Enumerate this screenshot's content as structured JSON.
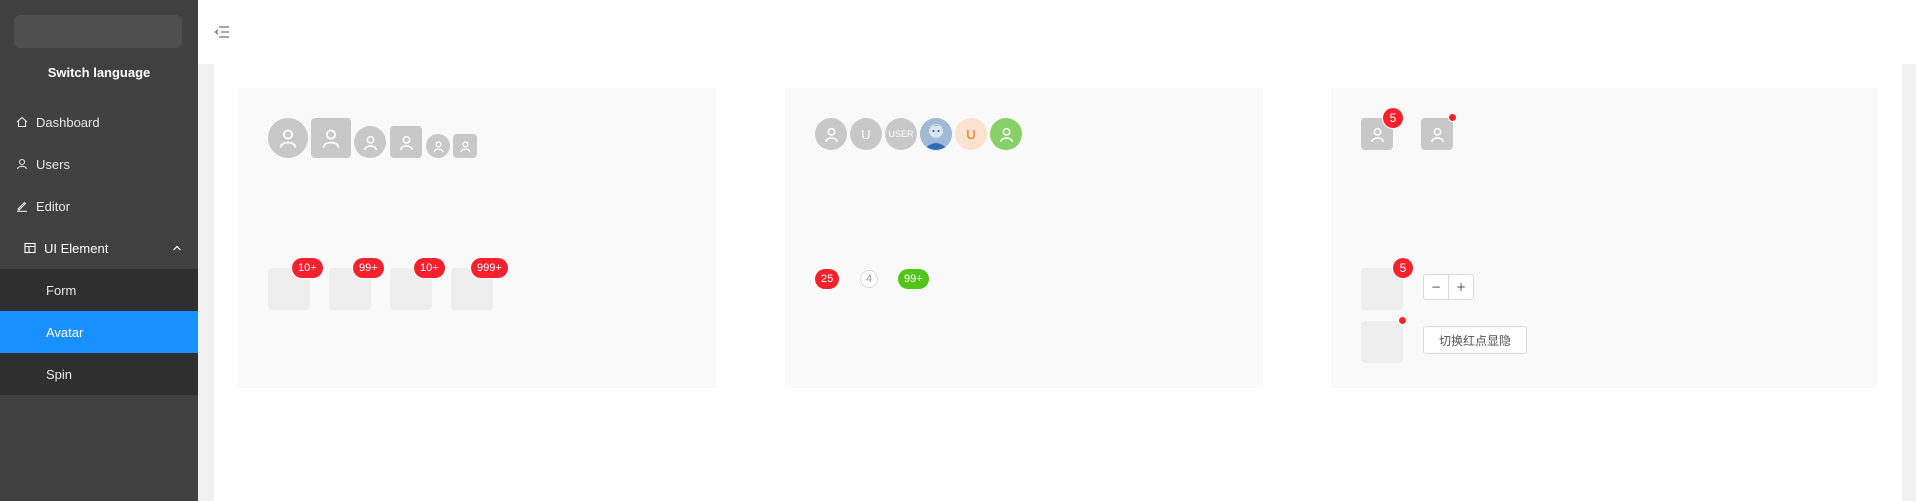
{
  "sidebar": {
    "switch_language": "Switch language",
    "items": [
      {
        "label": "Dashboard",
        "icon": "home-icon"
      },
      {
        "label": "Users",
        "icon": "user-icon"
      },
      {
        "label": "Editor",
        "icon": "edit-icon"
      },
      {
        "label": "UI Element",
        "icon": "layout-icon",
        "expanded": true
      }
    ],
    "sub_items": [
      {
        "label": "Form"
      },
      {
        "label": "Avatar",
        "active": true
      },
      {
        "label": "Spin"
      }
    ]
  },
  "header": {
    "menu_icon": "menu-fold-icon"
  },
  "card1": {
    "badges": [
      "10+",
      "99+",
      "10+",
      "999+"
    ]
  },
  "card2": {
    "avatars": [
      {
        "kind": "icon"
      },
      {
        "kind": "text",
        "text": "U"
      },
      {
        "kind": "text",
        "text": "USER"
      },
      {
        "kind": "image"
      },
      {
        "kind": "text",
        "text": "U",
        "color": "#f56a00",
        "bg": "#fde3cf"
      },
      {
        "kind": "icon",
        "bg": "#87d068"
      }
    ],
    "badges": [
      {
        "text": "25",
        "style": "red"
      },
      {
        "text": "4",
        "style": "outline"
      },
      {
        "text": "99+",
        "style": "green"
      }
    ]
  },
  "card3": {
    "top_badge": "5",
    "dyn_badge": "5",
    "minus_label": "−",
    "plus_label": "+",
    "toggle_label": "切换红点显隐"
  },
  "colors": {
    "sidebar_bg": "#404040",
    "submenu_bg": "#2f2f2f",
    "active": "#1890ff",
    "badge_red": "#f5222d",
    "badge_green": "#52c41a",
    "avatar_grey": "#c8c8c8"
  }
}
